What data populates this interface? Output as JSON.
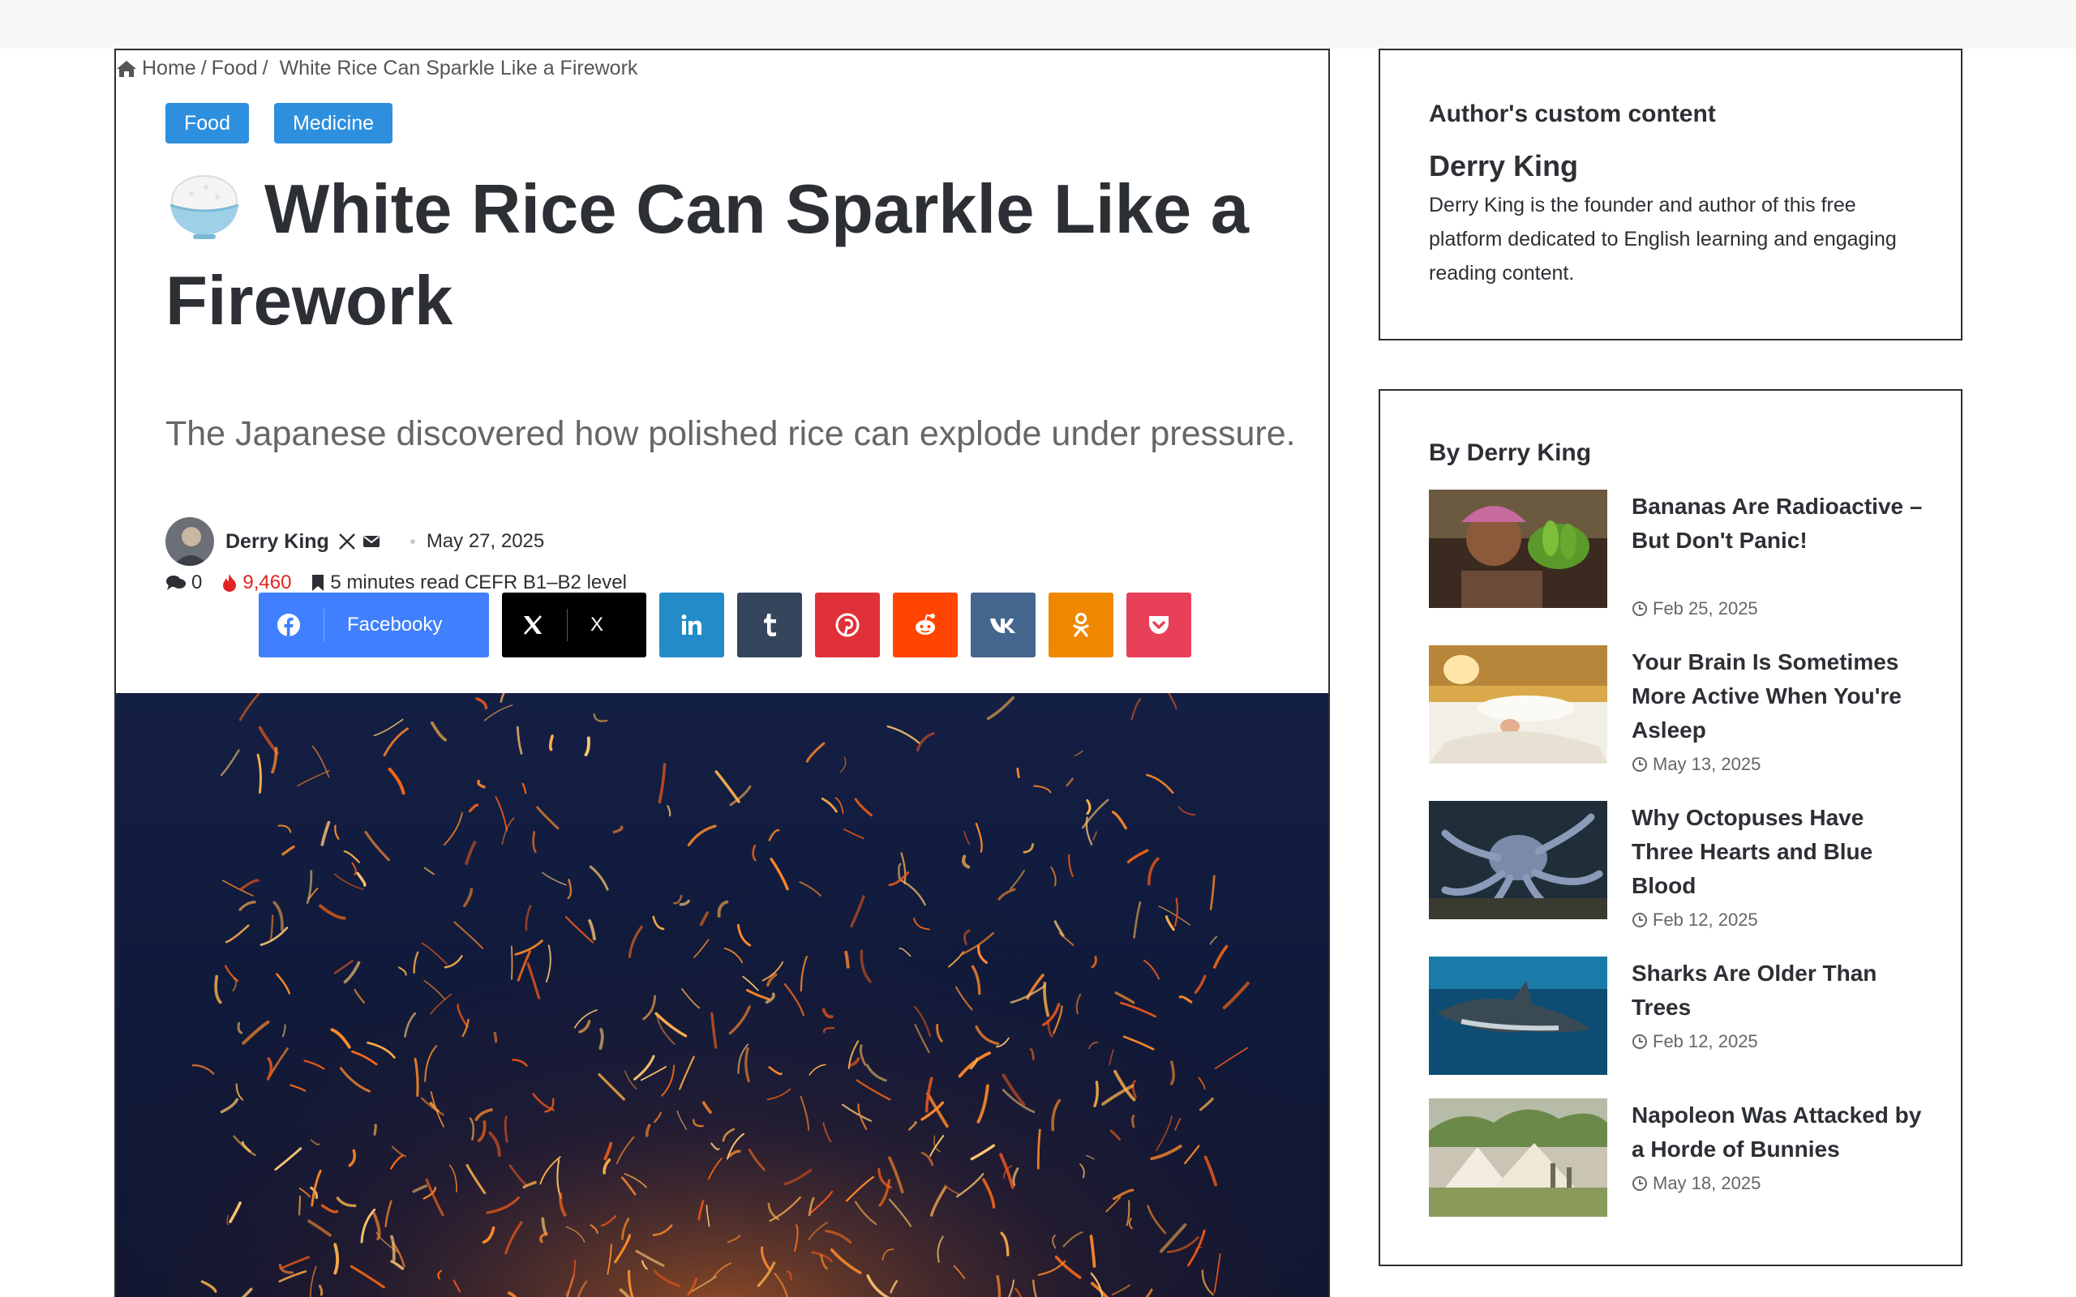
{
  "breadcrumb": {
    "home": "Home",
    "food": "Food",
    "current": "White Rice Can Sparkle Like a Firework"
  },
  "categories": [
    "Food",
    "Medicine"
  ],
  "article": {
    "title": "White Rice Can Sparkle Like a Firework",
    "subtitle": "The Japanese discovered how polished rice can explode under pressure.",
    "author": "Derry King",
    "date": "May 27, 2025",
    "comments": "0",
    "views": "9,460",
    "read_time": "5 minutes read CEFR B1–B2 level"
  },
  "share": {
    "facebook": "Facebooky",
    "x": "X"
  },
  "sidebar": {
    "custom": {
      "title": "Author's custom content",
      "name": "Derry King",
      "bio": "Derry King is the founder and author of this free platform dedicated to English learning and engaging reading content."
    },
    "by_author": {
      "title": "By Derry King",
      "posts": [
        {
          "title": "Bananas Are Radioactive – But Don't Panic!",
          "date": "Feb 25, 2025"
        },
        {
          "title": "Your Brain Is Sometimes More Active When You're Asleep",
          "date": "May 13, 2025"
        },
        {
          "title": "Why Octopuses Have Three Hearts and Blue Blood",
          "date": "Feb 12, 2025"
        },
        {
          "title": "Sharks Are Older Than Trees",
          "date": "Feb 12, 2025"
        },
        {
          "title": "Napoleon Was Attacked by a Horde of Bunnies",
          "date": "May 18, 2025"
        }
      ]
    }
  },
  "colors": {
    "category_bg": "#2d8fdd",
    "views_red": "#e02424",
    "facebook": "#4080ff",
    "linkedin": "#238cc8",
    "tumblr": "#35465c",
    "pinterest": "#e13138",
    "reddit": "#ff4500",
    "vk": "#45668e",
    "odnoklassniki": "#ef8800",
    "pocket": "#e9405a"
  }
}
